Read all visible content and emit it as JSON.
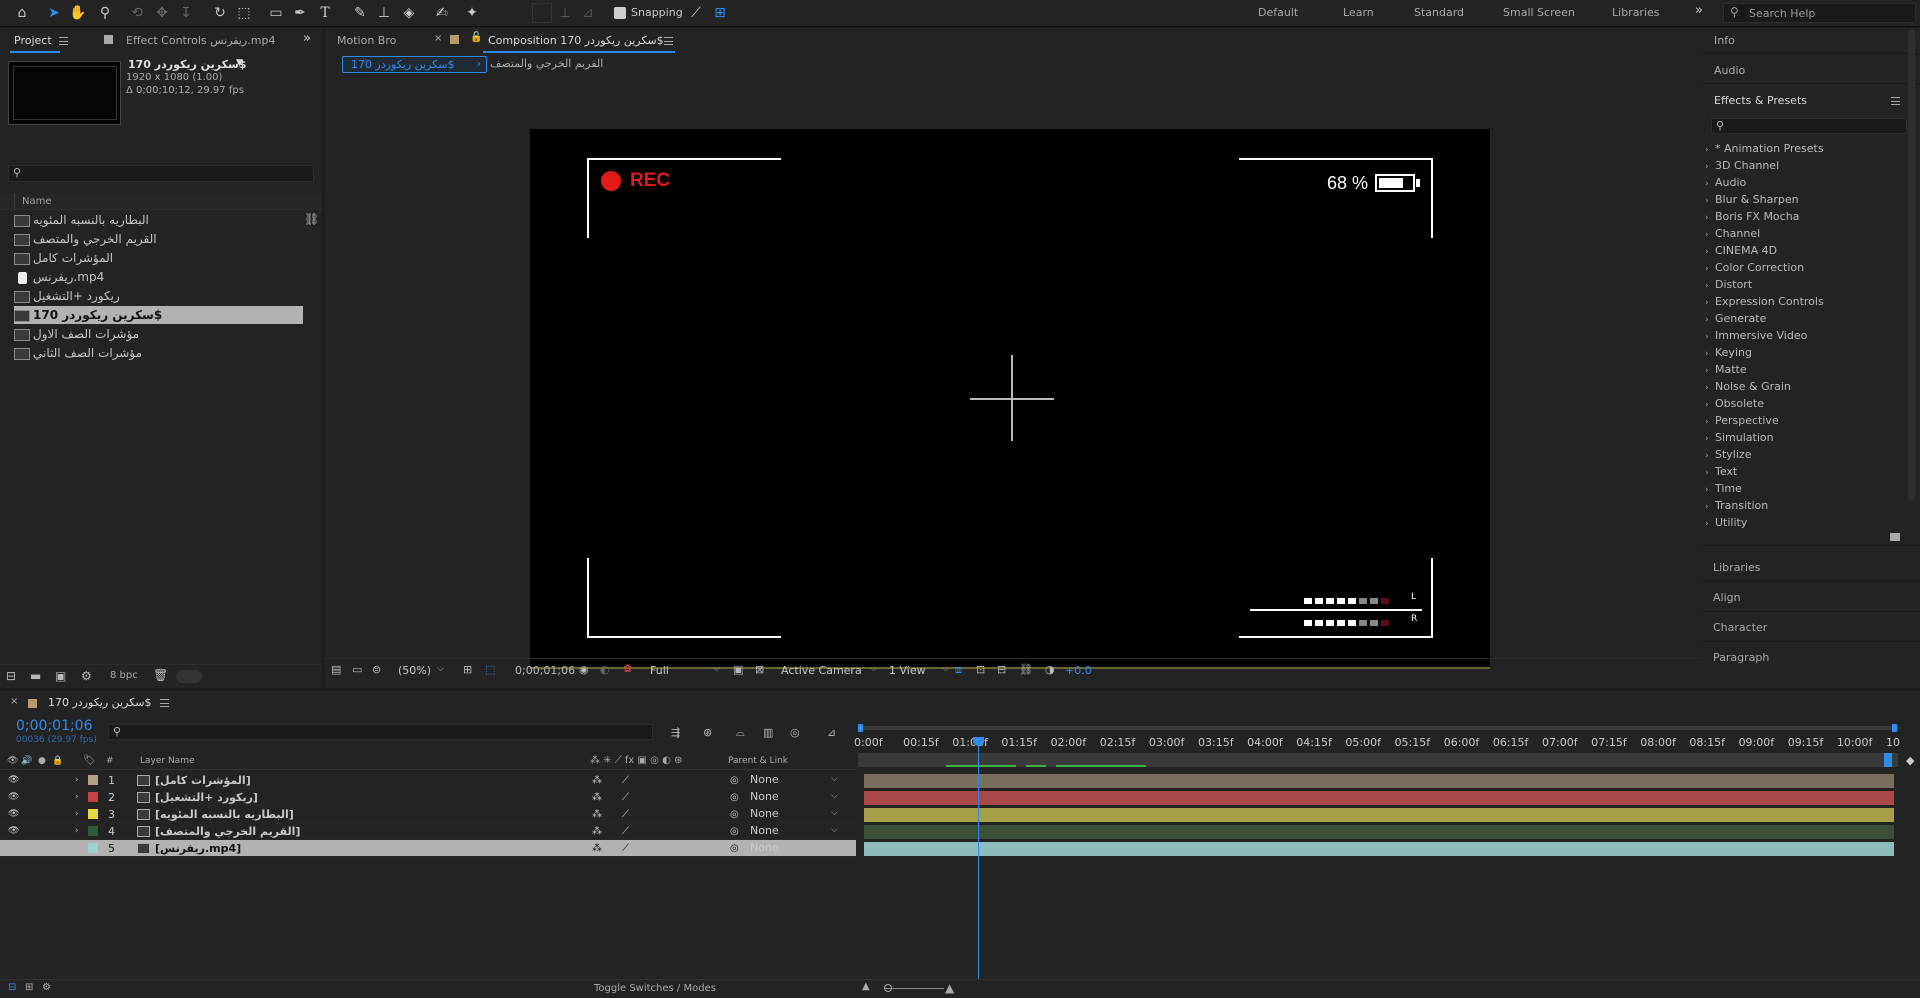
{
  "toolbar": {
    "snapping_label": "Snapping",
    "workspaces": [
      "Default",
      "Learn",
      "Standard",
      "Small Screen",
      "Libraries"
    ],
    "search_placeholder": "Search Help",
    "more_icon": "double-chevron-right-icon"
  },
  "project_panel": {
    "tab_label": "Project",
    "effect_controls_label": "Effect Controls ريفرنس.mp4",
    "comp_name": "سكرين ريكوردر 170$",
    "comp_res": "1920 x 1080 (1.00)",
    "comp_duration": "Δ 0;00;10;12, 29.97 fps",
    "search_placeholder": "",
    "column_name": "Name",
    "items": [
      {
        "name": "البطاريه بالنسبه المئويه",
        "type": "comp"
      },
      {
        "name": "القريم الخرجي والمتصف",
        "type": "comp"
      },
      {
        "name": "المؤشرات كامل",
        "type": "comp"
      },
      {
        "name": "ريفرنس.mp4",
        "type": "file"
      },
      {
        "name": "ريكورد +التشغيل",
        "type": "comp"
      },
      {
        "name": "سكرين ريكوردر 170$",
        "type": "comp",
        "selected": true
      },
      {
        "name": "مؤشرات الصف الاول",
        "type": "comp"
      },
      {
        "name": "مؤشرات الصف الثاني",
        "type": "comp"
      }
    ],
    "bpc_label": "8 bpc"
  },
  "comp_panel": {
    "tabs": [
      "Motion Bro",
      "Composition سكرين ريكوردر 170$"
    ],
    "breadcrumb": [
      "سكرين ريكوردر 170$",
      "القريم الخرجي والمتصف"
    ],
    "rec_label": "REC",
    "battery_label": "68 %",
    "meter_l": "L",
    "meter_r": "R",
    "zoom": "(50%)",
    "timecode": "0;00;01;06",
    "resolution": "Full",
    "camera": "Active Camera",
    "view": "1 View",
    "exposure": "+0.0"
  },
  "effects_panel": {
    "top_labels": [
      "Info",
      "Audio"
    ],
    "title": "Effects & Presets",
    "search_placeholder": "",
    "items": [
      "* Animation Presets",
      "3D Channel",
      "Audio",
      "Blur & Sharpen",
      "Boris FX Mocha",
      "Channel",
      "CINEMA 4D",
      "Color Correction",
      "Distort",
      "Expression Controls",
      "Generate",
      "Immersive Video",
      "Keying",
      "Matte",
      "Noise & Grain",
      "Obsolete",
      "Perspective",
      "Simulation",
      "Stylize",
      "Text",
      "Time",
      "Transition",
      "Utility"
    ],
    "bottom_labels": [
      "Libraries",
      "Align",
      "Character",
      "Paragraph"
    ]
  },
  "timeline": {
    "tab_label": "سكرين ريكوردر 170$",
    "timecode": "0;00;01;06",
    "frame_info": "00036 (29.97 fps)",
    "col_layer_name": "Layer Name",
    "col_parent": "Parent & Link",
    "col_hash": "#",
    "ruler": [
      "0:00f",
      "00:15f",
      "01:00f",
      "01:15f",
      "02:00f",
      "02:15f",
      "03:00f",
      "03:15f",
      "04:00f",
      "04:15f",
      "05:00f",
      "05:15f",
      "06:00f",
      "06:15f",
      "07:00f",
      "07:15f",
      "08:00f",
      "08:15f",
      "09:00f",
      "09:15f",
      "10:00f",
      "10"
    ],
    "layers": [
      {
        "num": "1",
        "name": "[المؤشرات كامل]",
        "color": "#b5a088",
        "parent": "None",
        "bar": "#7a6f5f"
      },
      {
        "num": "2",
        "name": "[ريكورد +التشغيل]",
        "color": "#c84040",
        "parent": "None",
        "bar": "#a84848"
      },
      {
        "num": "3",
        "name": "[البطاريه بالنسبه المئويه]",
        "color": "#e8d840",
        "parent": "None",
        "bar": "#a8a048"
      },
      {
        "num": "4",
        "name": "[القريم الخرجي والمتصف]",
        "color": "#2f5a3a",
        "parent": "None",
        "bar": "#3c5038"
      },
      {
        "num": "5",
        "name": "[ريفرنس.mp4]",
        "color": "#a0d0d0",
        "parent": "None",
        "bar": "#8ebcbc",
        "selected": true
      }
    ],
    "toggle_label": "Toggle Switches / Modes",
    "playhead_fraction": 0.1155
  }
}
